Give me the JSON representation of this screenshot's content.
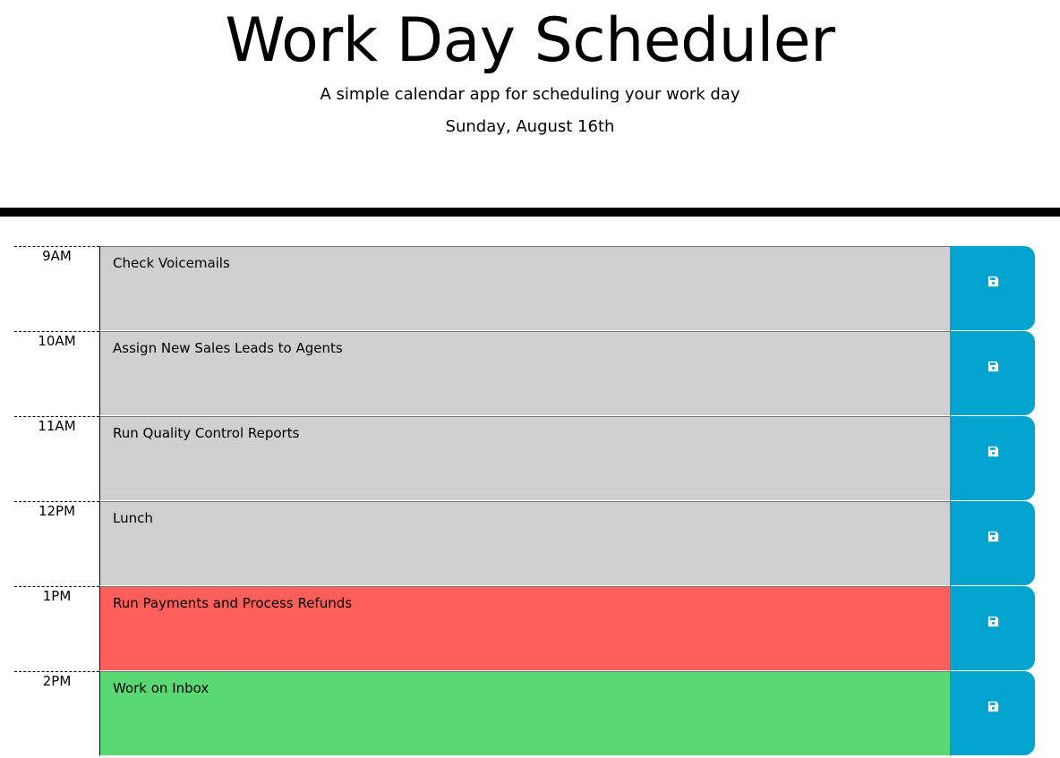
{
  "header": {
    "title": "Work Day Scheduler",
    "subtitle": "A simple calendar app for scheduling your work day",
    "current_day": "Sunday, August 16th"
  },
  "colors": {
    "past": "#d0d0d0",
    "present": "#ff5f5a",
    "future": "#5ad873",
    "save_button": "#02a3cf"
  },
  "time_blocks": [
    {
      "hour": "9AM",
      "task": "Check Voicemails",
      "status": "past"
    },
    {
      "hour": "10AM",
      "task": "Assign New Sales Leads to Agents",
      "status": "past"
    },
    {
      "hour": "11AM",
      "task": "Run Quality Control Reports",
      "status": "past"
    },
    {
      "hour": "12PM",
      "task": "Lunch",
      "status": "past"
    },
    {
      "hour": "1PM",
      "task": "Run Payments and Process Refunds",
      "status": "present"
    },
    {
      "hour": "2PM",
      "task": "Work on Inbox",
      "status": "future"
    }
  ],
  "icons": {
    "save": "floppy-disk-icon"
  }
}
